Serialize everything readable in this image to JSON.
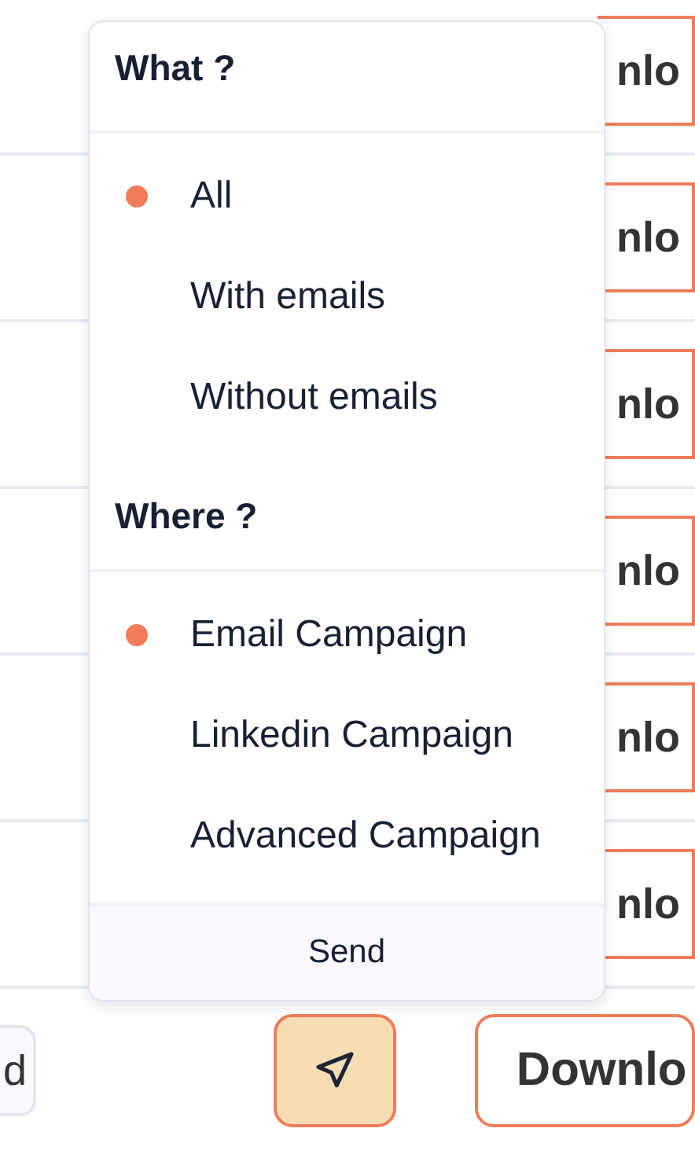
{
  "rows": [
    {
      "download_button": "nlo"
    },
    {
      "download_button": "nlo"
    },
    {
      "download_button": "nlo"
    },
    {
      "download_button": "nlo"
    },
    {
      "download_button": "nlo"
    },
    {
      "download_button": "nlo"
    }
  ],
  "bottom_row": {
    "left_button": "d",
    "download_button": "Downlo"
  },
  "menu": {
    "sections": [
      {
        "heading": "What ?",
        "options": [
          {
            "label": "All",
            "selected": true
          },
          {
            "label": "With emails",
            "selected": false
          },
          {
            "label": "Without emails",
            "selected": false
          }
        ]
      },
      {
        "heading": "Where ?",
        "options": [
          {
            "label": "Email Campaign",
            "selected": true
          },
          {
            "label": "Linkedin Campaign",
            "selected": false
          },
          {
            "label": "Advanced Campaign",
            "selected": false
          }
        ]
      }
    ],
    "footer_button": "Send"
  }
}
